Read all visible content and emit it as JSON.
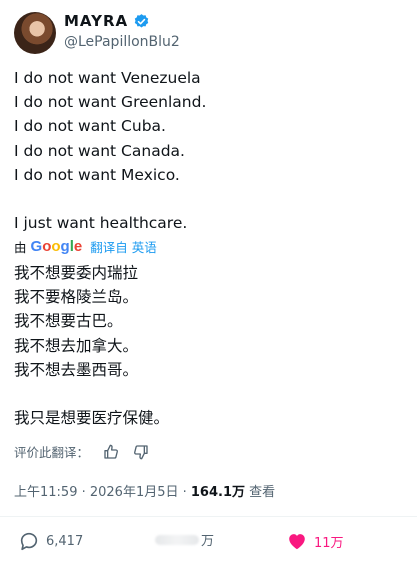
{
  "user": {
    "name": "MAYRA",
    "handle": "@LePapillonBlu2"
  },
  "tweet": {
    "lines": [
      "I do not want Venezuela",
      "I do not want Greenland.",
      "I do not want Cuba.",
      "I do not want Canada.",
      "I do not want Mexico.",
      "",
      "I just want healthcare."
    ]
  },
  "translation": {
    "by_label": "由",
    "provider": "Google",
    "link": "翻译自 英语",
    "lines": [
      "我不想要委内瑞拉",
      "我不要格陵兰岛。",
      "我不想要古巴。",
      "我不想去加拿大。",
      "我不想去墨西哥。",
      "",
      "我只是想要医疗保健。"
    ],
    "rate_label": "评价此翻译："
  },
  "meta": {
    "time": "上午11:59 · 2026年1月5日 · ",
    "views": "164.1万",
    "views_label": " 查看"
  },
  "actions": {
    "replies": "6,417",
    "retweets_suffix": "万",
    "likes": "11万"
  },
  "icons": [
    "verified-badge-icon",
    "thumbs-up-icon",
    "thumbs-down-icon",
    "reply-icon",
    "retweet-icon",
    "heart-icon"
  ],
  "colors": {
    "accent": "#1d9bf0",
    "like": "#f91880",
    "muted": "#536471"
  }
}
